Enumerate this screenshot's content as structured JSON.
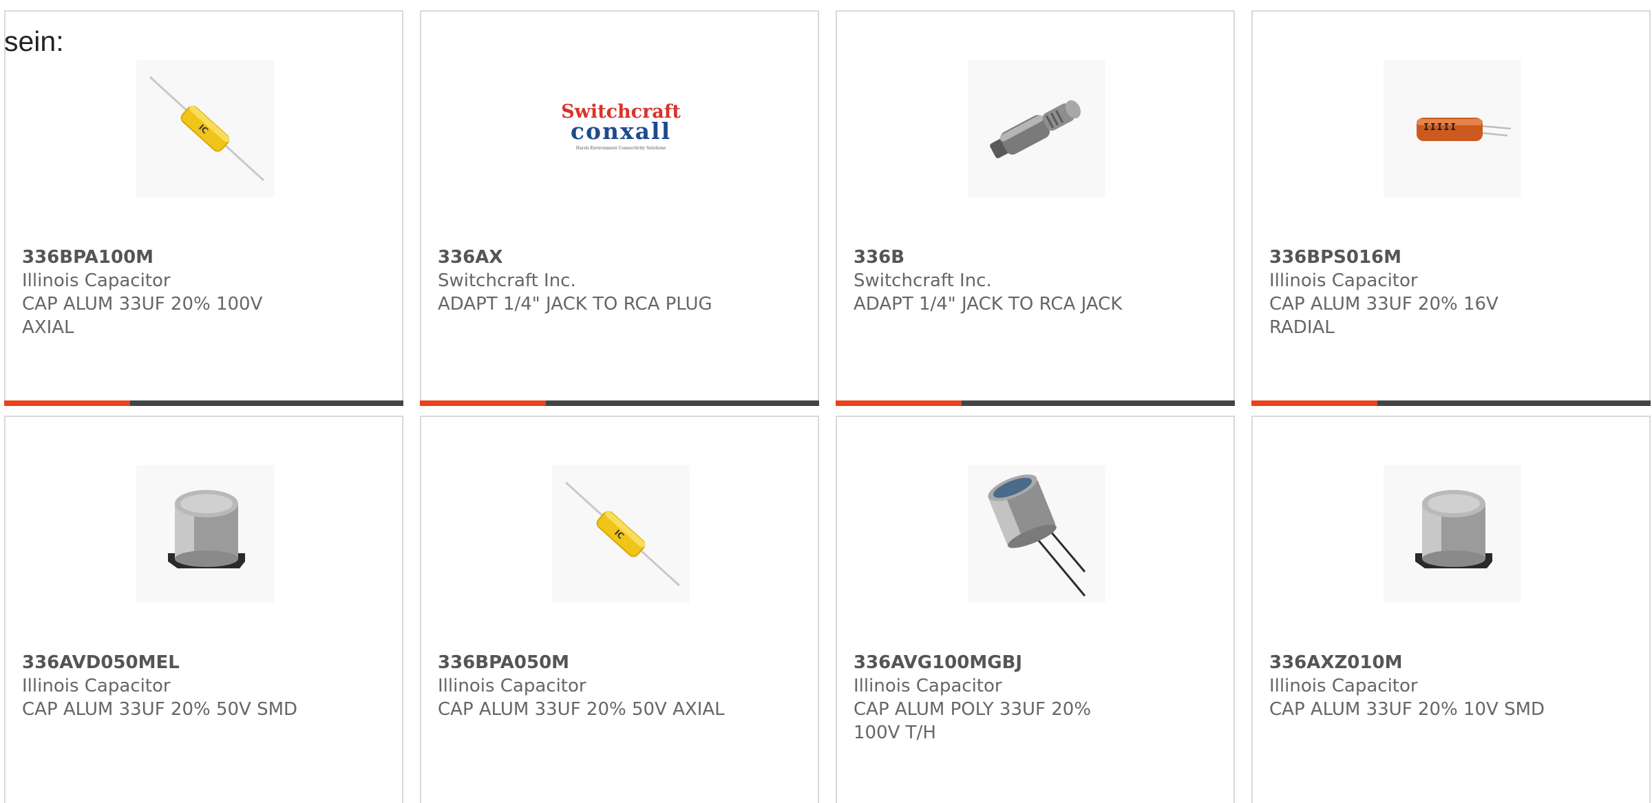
{
  "intro_text": "sein:",
  "colors": {
    "accent": "#e8431a",
    "bar_track": "#444444",
    "card_border": "#d9d9d9",
    "text": "#666666"
  },
  "products": [
    {
      "part_number": "336BPA100M",
      "manufacturer": "Illinois Capacitor",
      "description": "CAP ALUM 33UF 20% 100V AXIAL",
      "image": "axial-yellow-capacitor-icon"
    },
    {
      "part_number": "336AX",
      "manufacturer": "Switchcraft Inc.",
      "description": "ADAPT 1/4\" JACK TO RCA PLUG",
      "image": "switchcraft-conxall-logo",
      "logo_line1": "Switchcraft",
      "logo_line2": "conxall",
      "logo_tagline": "Harsh Environment Connectivity Solutions"
    },
    {
      "part_number": "336B",
      "manufacturer": "Switchcraft Inc.",
      "description": "ADAPT 1/4\" JACK TO RCA JACK",
      "image": "jack-adapter-icon"
    },
    {
      "part_number": "336BPS016M",
      "manufacturer": "Illinois Capacitor",
      "description": "CAP ALUM 33UF 20% 16V RADIAL",
      "image": "radial-orange-capacitor-icon"
    },
    {
      "part_number": "336AVD050MEL",
      "manufacturer": "Illinois Capacitor",
      "description": "CAP ALUM 33UF 20% 50V SMD",
      "image": "smd-capacitor-icon"
    },
    {
      "part_number": "336BPA050M",
      "manufacturer": "Illinois Capacitor",
      "description": "CAP ALUM 33UF 20% 50V AXIAL",
      "image": "axial-yellow-capacitor-icon"
    },
    {
      "part_number": "336AVG100MGBJ",
      "manufacturer": "Illinois Capacitor",
      "description": "CAP ALUM POLY 33UF 20% 100V T/H",
      "image": "polymer-through-hole-capacitor-icon"
    },
    {
      "part_number": "336AXZ010M",
      "manufacturer": "Illinois Capacitor",
      "description": "CAP ALUM 33UF 20% 10V SMD",
      "image": "smd-capacitor-icon"
    }
  ]
}
